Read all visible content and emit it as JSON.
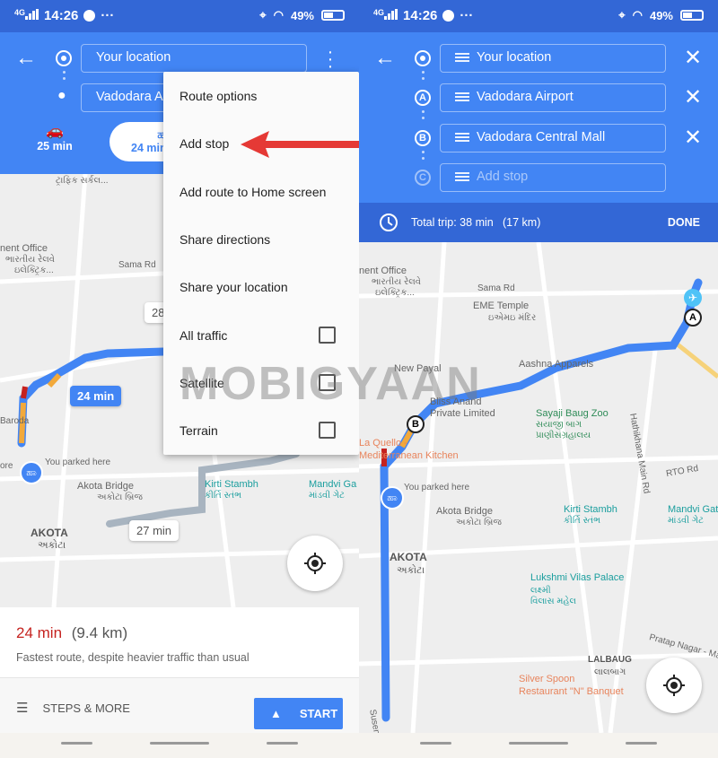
{
  "status_bar": {
    "network": "4G",
    "time": "14:26",
    "more": "···",
    "battery": "49%"
  },
  "left": {
    "origin": "Your location",
    "destination": "Vadodara Airport",
    "modes": [
      {
        "icon": "car-icon",
        "label": "25 min",
        "selected": false
      },
      {
        "icon": "motorcycle-icon",
        "label": "24 min",
        "selected": true
      }
    ],
    "overflow_menu": {
      "items": [
        {
          "label": "Route options",
          "checkbox": false
        },
        {
          "label": "Add stop",
          "checkbox": false,
          "highlighted_by_arrow": true
        },
        {
          "label": "Add route to Home screen",
          "checkbox": false
        },
        {
          "label": "Share directions",
          "checkbox": false
        },
        {
          "label": "Share your location",
          "checkbox": false
        },
        {
          "label": "All traffic",
          "checkbox": true,
          "checked": false
        },
        {
          "label": "Satellite",
          "checkbox": true,
          "checked": false
        },
        {
          "label": "Terrain",
          "checkbox": true,
          "checked": false
        }
      ]
    },
    "map": {
      "route_main_label": "24 min",
      "route_alt_label": "27 min",
      "route_alt2_partial": "28",
      "labels": [
        "ટ્રાફિક સર્કલ...",
        "nent Office",
        "ભારતીય રેલવે",
        "ઇલેક્ટ્રિક...",
        "Sama Rd",
        "Baroda",
        "ore",
        "You parked here",
        "Akota Bridge",
        "અકોટા બ્રિજ",
        "Kirti Stambh",
        "કીર્તિ સ્તંભ",
        "Mandvi Ga",
        "માંડવી ગેટ",
        "AKOTA",
        "અકોટા"
      ]
    },
    "summary": {
      "time": "24 min",
      "distance": "(9.4 km)",
      "note": "Fastest route, despite heavier traffic than usual"
    },
    "actions": {
      "steps": "STEPS & MORE",
      "start": "START"
    }
  },
  "right": {
    "stops": [
      {
        "marker": "origin",
        "label": "Your location",
        "placeholder": false
      },
      {
        "marker": "A",
        "label": "Vadodara Airport",
        "placeholder": false
      },
      {
        "marker": "B",
        "label": "Vadodara Central Mall",
        "placeholder": false
      },
      {
        "marker": "C",
        "label": "Add stop",
        "placeholder": true
      }
    ],
    "trip": {
      "text": "Total trip: 38 min",
      "distance": "(17 km)",
      "done": "DONE"
    },
    "map": {
      "labels": [
        "nent Office",
        "ભારતીય રેલવે",
        "ઇલેક્ટ્રિક...",
        "Sama Rd",
        "EME Temple",
        "ઇએમઇ મંદિર",
        "New Payal",
        "Aashna Apparels",
        "Bliss Anand",
        "Private Limited",
        "Sayaji Baug Zoo",
        "સયાજી બાગ",
        "પ્રાણીસંગ્રહાલય",
        "La Quello -",
        "Mediterranean Kitchen",
        "Hathikhana Main Rd",
        "RTO Rd",
        "You parked here",
        "Akota Bridge",
        "અકોટા બ્રિજ",
        "Kirti Stambh",
        "કીર્તિ સ્તંભ",
        "Mandvi Gat",
        "માંડવી ગેટ",
        "AKOTA",
        "અકોટા",
        "Lukshmi Vilas Palace",
        "લક્ષ્મી",
        "વિલાસ મહેલ",
        "Pratap Nagar - Maka",
        "LALBAUG",
        "લાલબાગ",
        "Silver Spoon",
        "Restaurant \"N\" Banquet",
        "Susen"
      ],
      "markers": [
        "A",
        "B"
      ]
    }
  },
  "watermark": "MOBIGYAAN",
  "colors": {
    "status_bar": "#3367d6",
    "header": "#4285f4",
    "trip_bar": "#3367d6",
    "route": "#4285f4",
    "alt_route": "#a8b4c0",
    "accent_red": "#c5221f",
    "arrow": "#e53935"
  }
}
